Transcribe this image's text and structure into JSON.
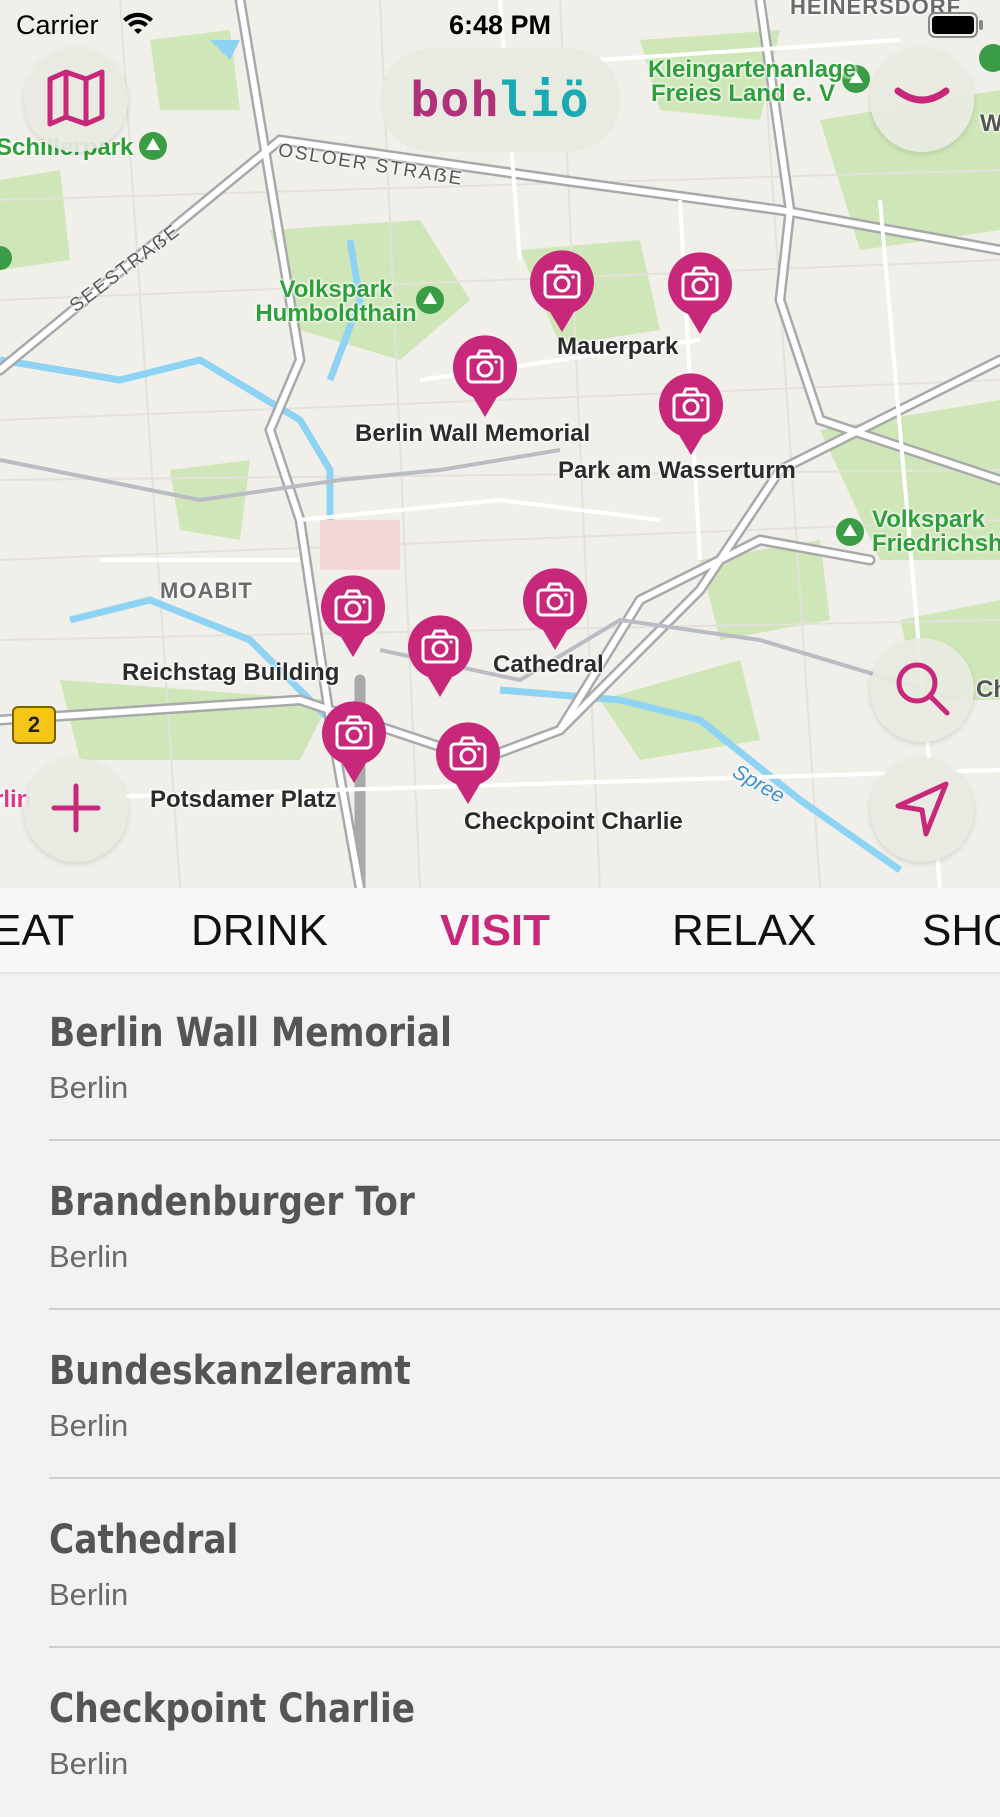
{
  "status_bar": {
    "carrier": "Carrier",
    "time": "6:48 PM"
  },
  "header": {
    "logo_part1": "boh",
    "logo_part2": "liö"
  },
  "map": {
    "park_labels": [
      "Volkspark Humboldthain",
      "Kleingartenanlage Freies Land e. V",
      "Volkspark Friedrichsh"
    ],
    "district_labels": [
      "MOABIT",
      "HEINERSDORF"
    ],
    "street_labels": [
      "OSLOER STRAẞE",
      "SEESTRAẞE"
    ],
    "river_label": "Spree",
    "route_badge": "2",
    "poi_labels": [
      "Mauerpark",
      "Berlin Wall Memorial",
      "Park am Wasserturm",
      "Reichstag Building",
      "Cathedral",
      "Potsdamer Platz",
      "Checkpoint Charlie"
    ],
    "edge_labels": [
      "Schillerpark",
      "W",
      "Ch",
      "rlin"
    ]
  },
  "tabs": [
    "EAT",
    "DRINK",
    "VISIT",
    "RELAX",
    "SHO"
  ],
  "active_tab": "VISIT",
  "places": [
    {
      "name": "Berlin Wall Memorial",
      "city": "Berlin"
    },
    {
      "name": "Brandenburger Tor",
      "city": "Berlin"
    },
    {
      "name": "Bundeskanzleramt",
      "city": "Berlin"
    },
    {
      "name": "Cathedral",
      "city": "Berlin"
    },
    {
      "name": "Checkpoint Charlie",
      "city": "Berlin"
    }
  ],
  "colors": {
    "accent": "#c8287a",
    "logo_teal": "#1aaab2",
    "pin": "#c8287a",
    "park": "#2e9f3b"
  },
  "icons": [
    "map-icon",
    "chevron-down-icon",
    "search-icon",
    "location-arrow-icon",
    "plus-icon",
    "camera-pin-icon",
    "wifi-icon",
    "battery-icon"
  ]
}
